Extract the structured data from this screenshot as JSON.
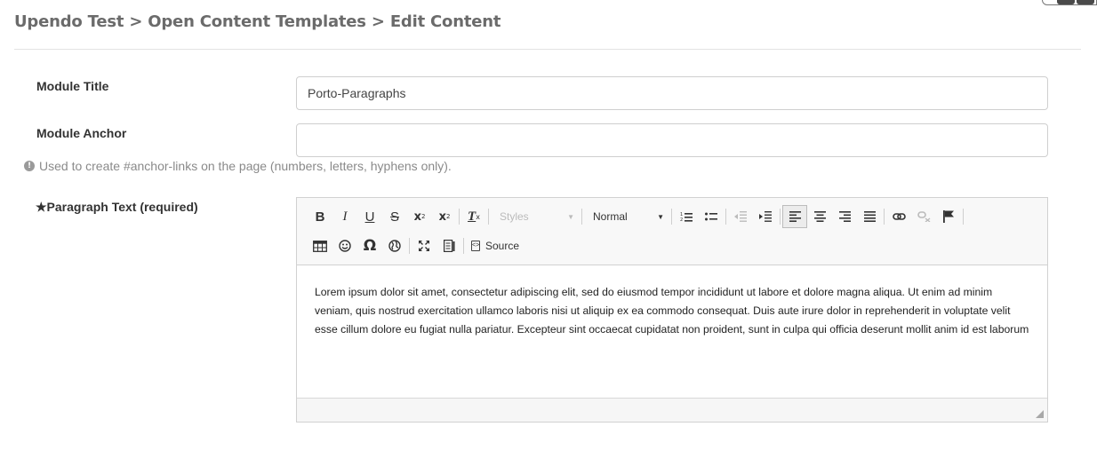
{
  "breadcrumb": "Upendo Test > Open Content Templates > Edit Content",
  "fields": {
    "module_title": {
      "label": "Module Title",
      "value": "Porto-Paragraphs",
      "placeholder": ""
    },
    "module_anchor": {
      "label": "Module Anchor",
      "value": "",
      "placeholder": "",
      "help": "Used to create #anchor-links on the page (numbers, letters, hyphens only)."
    },
    "paragraph_text": {
      "label": "★Paragraph Text (required)"
    }
  },
  "editor": {
    "toolbar": {
      "bold": "B",
      "italic": "I",
      "underline": "U",
      "strike": "S",
      "subscript_base": "x",
      "subscript_mark": "2",
      "superscript_base": "x",
      "superscript_mark": "2",
      "remove_format": "T",
      "styles_label": "Styles",
      "format_label": "Normal",
      "special_char": "Ω",
      "source_label": "Source"
    },
    "content": "Lorem ipsum dolor sit amet, consectetur adipiscing elit, sed do eiusmod tempor incididunt ut labore et dolore magna aliqua. Ut enim ad minim veniam, quis nostrud exercitation ullamco laboris nisi ut aliquip ex ea commodo consequat. Duis aute irure dolor in reprehenderit in voluptate velit esse cillum dolore eu fugiat nulla pariatur. Excepteur sint occaecat cupidatat non proident, sunt in culpa qui officia deserunt mollit anim id est laborum",
    "active_alignment": "align-left"
  }
}
